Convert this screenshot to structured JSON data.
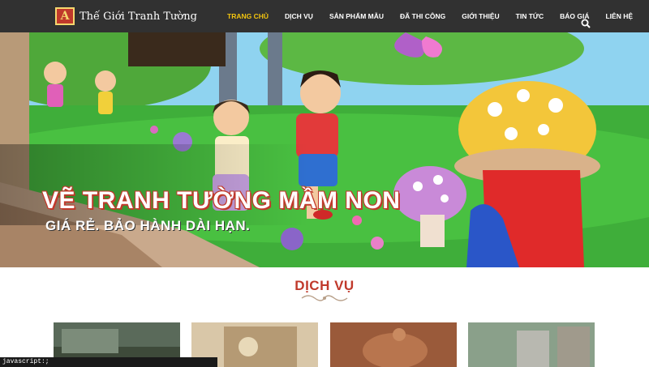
{
  "header": {
    "logo_mark": "A",
    "logo_text": "Thế Giới Tranh Tường",
    "nav": [
      {
        "label": "TRANG CHỦ",
        "active": true
      },
      {
        "label": "DỊCH VỤ"
      },
      {
        "label": "SẢN PHẨM MẪU"
      },
      {
        "label": "ĐÃ THI CÔNG"
      },
      {
        "label": "GIỚI THIỆU"
      },
      {
        "label": "TIN TỨC"
      },
      {
        "label": "BÁO GIÁ"
      },
      {
        "label": "LIÊN HỆ"
      }
    ],
    "search_icon": "search-icon"
  },
  "hero": {
    "title": "VẼ TRANH TƯỜNG MẦM NON",
    "subtitle": "GIÁ RẺ. BẢO HÀNH DÀI HẠN."
  },
  "services": {
    "title": "DỊCH VỤ"
  },
  "statusbar": {
    "text": "javascript:;"
  },
  "colors": {
    "accent": "#c0392b",
    "nav_active": "#f2c40f",
    "header_bg": "#141414"
  }
}
